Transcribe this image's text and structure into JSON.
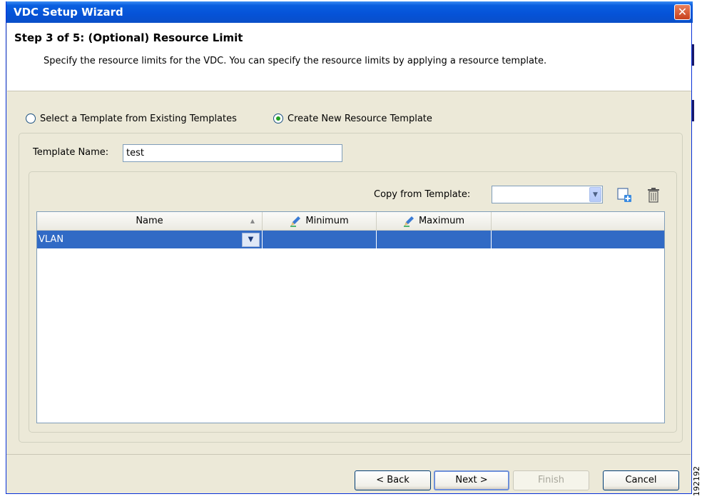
{
  "window": {
    "title": "VDC Setup Wizard",
    "close_glyph": "✕"
  },
  "header": {
    "step_title": "Step 3 of 5: (Optional) Resource Limit",
    "description": "Specify the resource limits for the VDC. You can specify the resource limits by applying a resource template."
  },
  "options": {
    "existing_label": "Select a Template from Existing Templates",
    "new_label": "Create New Resource Template",
    "selected": "new"
  },
  "template": {
    "name_label": "Template Name:",
    "name_value": "test"
  },
  "copy": {
    "label": "Copy from Template:",
    "value": ""
  },
  "table": {
    "columns": [
      "Name",
      "Minimum",
      "Maximum"
    ],
    "rows": [
      {
        "name": "VLAN",
        "minimum": "",
        "maximum": ""
      }
    ]
  },
  "buttons": {
    "back": "< Back",
    "next": "Next >",
    "finish": "Finish",
    "cancel": "Cancel"
  },
  "watermark": "192192",
  "icons": {
    "add": "add-template-icon",
    "delete": "trash-icon",
    "edit": "pencil-icon"
  }
}
